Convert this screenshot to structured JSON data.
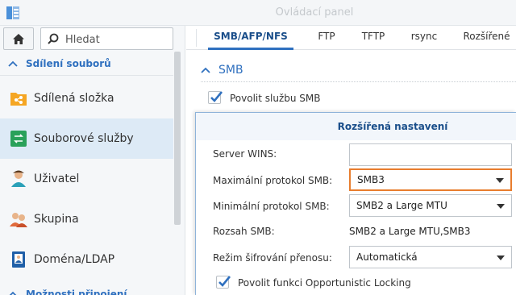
{
  "window": {
    "title": "Ovládací panel"
  },
  "sidebar": {
    "search_placeholder": "Hledat",
    "section_top": "Sdílení souborů",
    "section_bottom": "Možnosti připojení",
    "items": [
      {
        "label": "Sdílená složka",
        "icon": "shared-folder-icon"
      },
      {
        "label": "Souborové služby",
        "icon": "file-services-icon",
        "active": true
      },
      {
        "label": "Uživatel",
        "icon": "user-icon"
      },
      {
        "label": "Skupina",
        "icon": "group-icon"
      },
      {
        "label": "Doména/LDAP",
        "icon": "domain-ldap-icon"
      }
    ]
  },
  "tabs": [
    "SMB/AFP/NFS",
    "FTP",
    "TFTP",
    "rsync",
    "Rozšířené"
  ],
  "smb": {
    "section_title": "SMB",
    "enable_label": "Povolit službu SMB",
    "enable_checked": true
  },
  "dialog": {
    "title": "Rozšířená nastavení",
    "wins_label": "Server WINS:",
    "wins_value": "",
    "max_label": "Maximální protokol SMB:",
    "max_value": "SMB3",
    "min_label": "Minimální protokol SMB:",
    "min_value": "SMB2 a Large MTU",
    "range_label": "Rozsah SMB:",
    "range_value": "SMB2 a Large MTU,SMB3",
    "enc_label": "Režim šifrování přenosu:",
    "enc_value": "Automatická",
    "oplock_label": "Povolit funkci Opportunistic Locking",
    "oplock_checked": true
  },
  "colors": {
    "accent": "#2f70bf",
    "highlight": "#e87d2e",
    "active_bg": "#ddeaf6"
  }
}
